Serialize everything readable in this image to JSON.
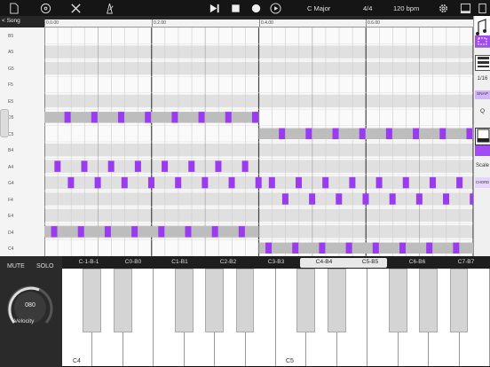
{
  "toolbar": {
    "key": "C Major",
    "time_signature": "4/4",
    "tempo": "120 bpm"
  },
  "song_button": "< Song",
  "ruler_marks": [
    "0.0.00",
    "0.2.00",
    "0.4.00",
    "0.6.00"
  ],
  "note_labels": [
    "B5",
    "A5",
    "G5",
    "F5",
    "E5",
    "D5",
    "C5",
    "B4",
    "A4",
    "G4",
    "F4",
    "E4",
    "D4",
    "C4"
  ],
  "right_panel": {
    "grid_value": "1/16",
    "snap_label": "SNAP",
    "quantize_label": "Q",
    "scale_label": "Scale",
    "chord_label": "CHORD"
  },
  "left_controls": {
    "mute_label": "MUTE",
    "solo_label": "SOLO",
    "knob_value": "080",
    "knob_label": "Velocity"
  },
  "octave_ranges": [
    "C-1-B-1",
    "C0-B0",
    "C1-B1",
    "C2-B2",
    "C3-B3",
    "C4-B4",
    "C5-B5",
    "C6-B6",
    "C7-B7"
  ],
  "selected_octave_range": "C4-B4",
  "keyboard_labels": [
    "C4",
    "C5"
  ],
  "colors": {
    "note": "#9b3bf0",
    "note_lane": "#bdbdbd",
    "accent": "#a24cf5"
  }
}
